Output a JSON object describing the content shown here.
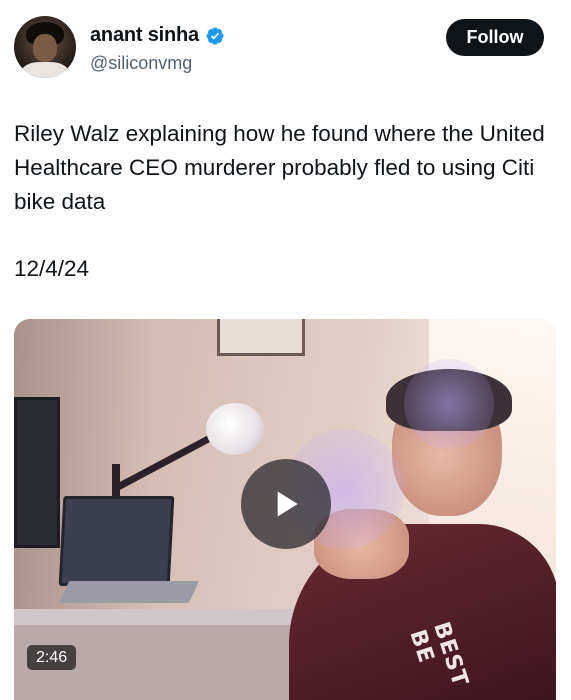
{
  "author": {
    "display_name": "anant sinha",
    "handle": "@siliconvmg",
    "verified_icon": "verified-badge-icon",
    "verified_color": "#1d9bf0"
  },
  "follow_button": {
    "label": "Follow"
  },
  "tweet": {
    "text": "Riley Walz explaining how he found where the United Healthcare CEO murderer probably fled to using Citi bike data",
    "date": "12/4/24"
  },
  "video": {
    "duration": "2:46",
    "play_icon": "play-icon",
    "shirt_text": "BEST BE"
  },
  "colors": {
    "text_primary": "#0f1419",
    "text_secondary": "#536471",
    "button_bg": "#0f1419",
    "button_text": "#ffffff"
  }
}
